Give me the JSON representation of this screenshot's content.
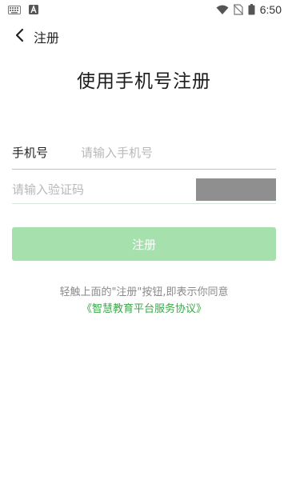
{
  "status_bar": {
    "time": "6:50",
    "left_icons": [
      "keyboard-icon",
      "a-badge-icon"
    ],
    "right_icons": [
      "wifi-icon",
      "no-sim-icon",
      "battery-icon"
    ]
  },
  "header": {
    "back_icon": "chevron-left-icon",
    "title": "注册"
  },
  "page_title": "使用手机号注册",
  "form": {
    "phone_label": "手机号",
    "phone_placeholder": "请输入手机号",
    "code_placeholder": "请输入验证码",
    "submit_label": "注册"
  },
  "agreement": {
    "text": "轻触上面的\"注册\"按钮,即表示你同意",
    "link": "《智慧教育平台服务协议》"
  },
  "colors": {
    "accent": "#3aa84a",
    "button_disabled": "#a6e0ad",
    "underline_active": "#9fd3b0",
    "captcha_bg": "#8f8f8f"
  }
}
